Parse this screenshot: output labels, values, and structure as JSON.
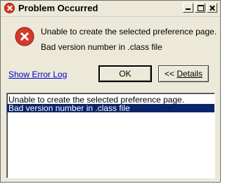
{
  "window": {
    "title": "Problem Occurred",
    "controls": [
      "minimize",
      "maximize",
      "close"
    ]
  },
  "message": {
    "icon": "error-icon",
    "line1": "Unable to create the selected preference page.",
    "line2": "Bad version number in .class file"
  },
  "link": {
    "label": "Show Error Log"
  },
  "buttons": {
    "ok_label": "OK",
    "details_prefix": "<< ",
    "details_label": "Details"
  },
  "details": {
    "lines": [
      "Unable to create the selected preference page.",
      "Bad version number in .class file"
    ],
    "selected_index": 1
  },
  "colors": {
    "dialog_bg": "#ece9d8",
    "selection": "#0a246a",
    "error_red": "#d43a2a",
    "link": "#0000cc"
  }
}
